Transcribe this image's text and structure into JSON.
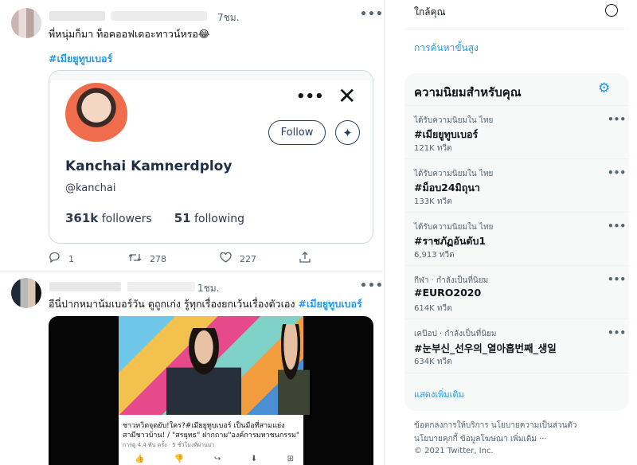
{
  "feed": {
    "tweet1": {
      "time": "7ชม.",
      "more_label": "•••",
      "text": "พี่หนุ่มก็มา ท็อคออฟเดอะทาวน์หรอ😂",
      "hashtag": "#เมียยูทูบเบอร์",
      "card": {
        "name": "Kanchai Kamnerdploy",
        "handle": "@kanchai",
        "followers_count": "361k",
        "followers_label": "followers",
        "following_count": "51",
        "following_label": "following",
        "follow_button": "Follow",
        "more_label": "•••",
        "close_label": "✕",
        "spark_label": "✦"
      },
      "actions": {
        "reply": "1",
        "retweet": "278",
        "like": "227"
      }
    },
    "tweet2": {
      "time": "1ชม.",
      "more_label": "•••",
      "text": "อีนี่ปากหมาน้มเบอร์วัน ดูถูกเก่ง รู้ทุกเรื่องยกเว้นเรื่องตัวเอง",
      "hashtag": "#เมียยูทูบเบอร์",
      "media": {
        "caption_line1": "ชาวทวิตจุดยับ!ใคร?#เมียยูทูบเบอร์ เป็นมือที่สามแย่ง",
        "caption_line2": "สามีชาวบ้าน! / \"สรยุทธ\" ฝากถาม\"องค์การมหาชนกรรม\"",
        "meta": "การดู 4.4 พัน ครั้ง · 5 ชั่วโมงที่ผ่านมา"
      }
    }
  },
  "sidebar": {
    "nearby_label": "ใกล้คุณ",
    "advanced_search": "การค้นหาขั้นสูง",
    "trends_title": "ความนิยมสำหรับคุณ",
    "trends": [
      {
        "context": "ได้รับความนิยมใน ไทย",
        "name": "#เมียยูทูบเบอร์",
        "count": "121K ทวีต"
      },
      {
        "context": "ได้รับความนิยมใน ไทย",
        "name": "#ม็อบ24มิถุนา",
        "count": "133K ทวีต"
      },
      {
        "context": "ได้รับความนิยมใน ไทย",
        "name": "#ราชภัฏอันดับ1",
        "count": "6,913 ทวีต"
      },
      {
        "context": "กีฬา · กำลังเป็นที่นิยม",
        "name": "#EURO2020",
        "count": "614K ทวีต"
      },
      {
        "context": "เคป๊อป · กำลังเป็นที่นิยม",
        "name": "#눈부신_선우의_열아홉번째_생일",
        "count": "634K ทวีต"
      }
    ],
    "trend_more_label": "•••",
    "show_more": "แสดงเพิ่มเติม",
    "footer": {
      "line1": "ข้อตกลงการให้บริการ   นโยบายความเป็นส่วนตัว",
      "line2": "นโยบายคุกกี้   ข้อมูลโฆษณา   เพิ่มเติม ···",
      "copyright": "© 2021 Twitter, Inc."
    }
  },
  "colors": {
    "accent": "#1d9bf0",
    "text": "#0f1419",
    "muted": "#536471",
    "panel": "#f7f9f9"
  }
}
